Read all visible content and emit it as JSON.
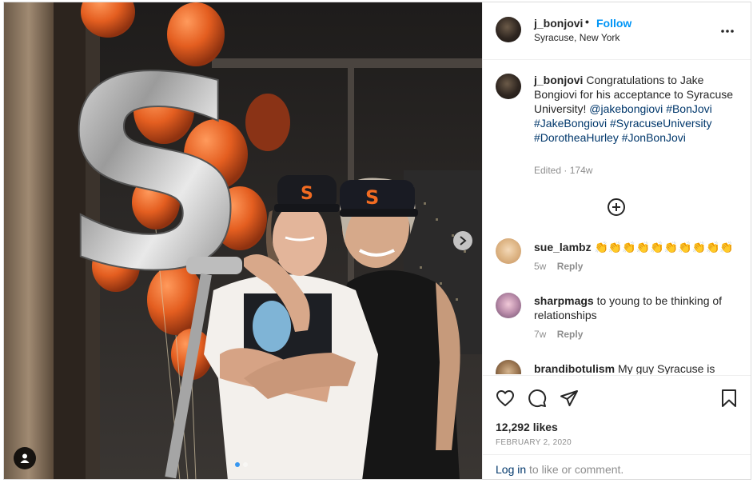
{
  "post": {
    "username": "j_bonjovi",
    "follow_label": "Follow",
    "bullet": "•",
    "location": "Syracuse, New York",
    "caption_username": "j_bonjovi",
    "caption_text": "Congratulations to Jake Bongiovi for his acceptance to Syracuse University!",
    "caption_mention": "@jakebongiovi",
    "caption_tags": [
      "#BonJovi",
      "#JakeBongiovi",
      "#SyracuseUniversity",
      "#DorotheaHurley",
      "#JonBonJovi"
    ],
    "caption_edited": "Edited",
    "caption_sep": "·",
    "caption_age": "174w",
    "cap_letter": "S",
    "balloon_letter": "S"
  },
  "comments": [
    {
      "username": "sue_lambz",
      "text": "👏👏👏👏👏👏👏👏👏👏",
      "age": "5w",
      "reply": "Reply"
    },
    {
      "username": "sharpmags",
      "text": "to young to be thinking of relationships",
      "age": "7w",
      "reply": "Reply"
    },
    {
      "username": "brandibotulism",
      "text": "My guy Syracuse is"
    }
  ],
  "engagement": {
    "likes": "12,292 likes",
    "date": "FEBRUARY 2, 2020",
    "login_link": "Log in",
    "login_suffix": " to like or comment."
  },
  "icons": {
    "more": "more-options-icon",
    "load_more": "plus-circle-icon",
    "like": "heart-icon",
    "comment": "comment-icon",
    "share": "share-icon",
    "save": "bookmark-icon",
    "next": "chevron-right-icon",
    "tag": "user-tag-icon"
  },
  "colors": {
    "follow": "#0095f6",
    "link": "#00376b",
    "muted": "#8e8e8e",
    "balloon_orange": "#e8692a",
    "cap_logo": "#f26b21"
  }
}
